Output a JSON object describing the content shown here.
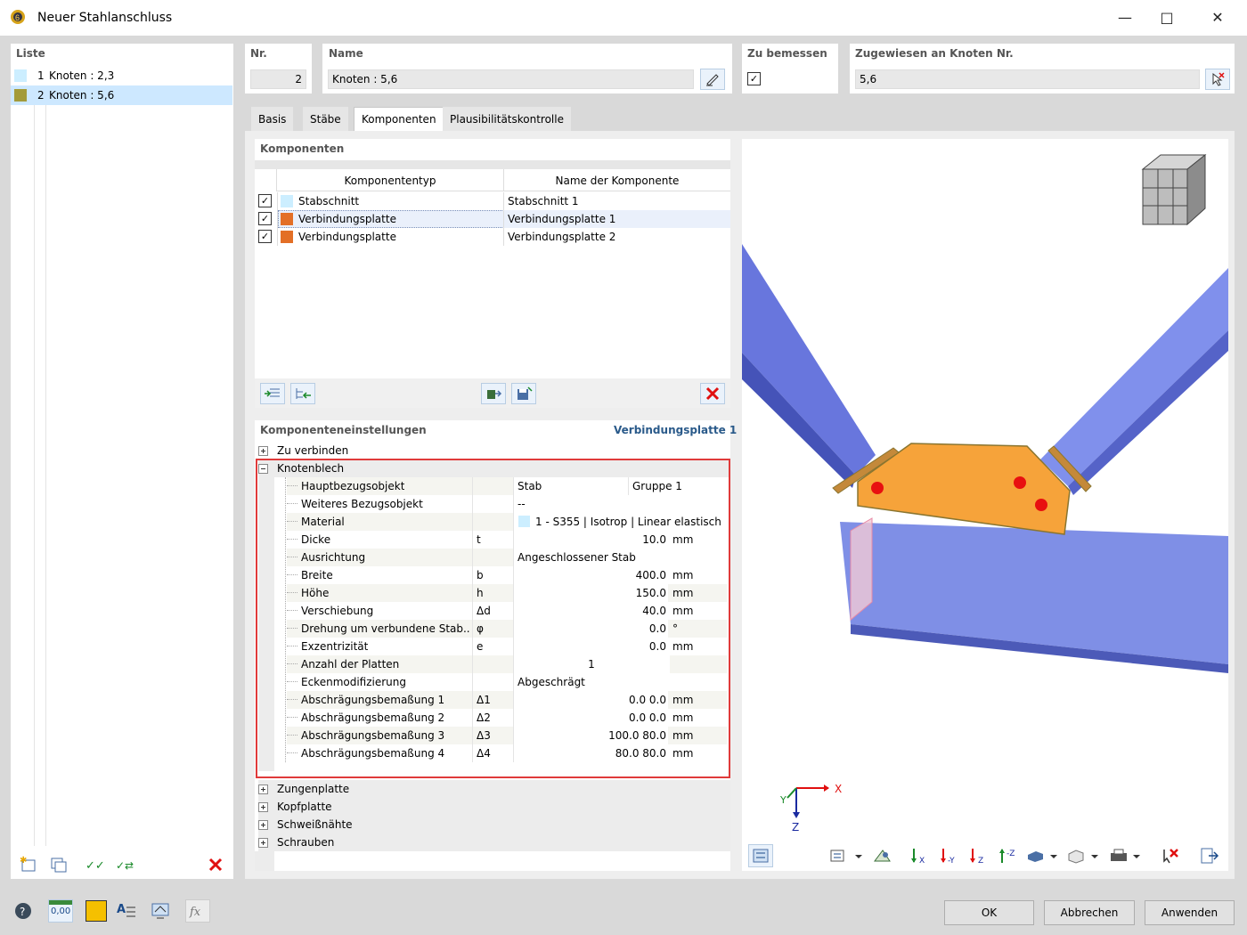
{
  "window": {
    "title": "Neuer Stahlanschluss"
  },
  "liste": {
    "header": "Liste",
    "items": [
      {
        "nr": "1",
        "label": "Knoten : 2,3",
        "color": "#cceeff"
      },
      {
        "nr": "2",
        "label": "Knoten : 5,6",
        "color": "#a39b3a"
      }
    ]
  },
  "fields": {
    "nr_label": "Nr.",
    "nr_value": "2",
    "name_label": "Name",
    "name_value": "Knoten : 5,6",
    "bemessen_label": "Zu bemessen",
    "zugewiesen_label": "Zugewiesen an Knoten Nr.",
    "zugewiesen_value": "5,6"
  },
  "tabs": [
    "Basis",
    "Stäbe",
    "Komponenten",
    "Plausibilitätskontrolle"
  ],
  "komponenten": {
    "header": "Komponenten",
    "col_typ": "Komponententyp",
    "col_name": "Name der Komponente",
    "rows": [
      {
        "typ": "Stabschnitt",
        "name": "Stabschnitt 1",
        "color": "#cceeff"
      },
      {
        "typ": "Verbindungsplatte",
        "name": "Verbindungsplatte 1",
        "color": "#e36f26"
      },
      {
        "typ": "Verbindungsplatte",
        "name": "Verbindungsplatte 2",
        "color": "#e36f26"
      }
    ]
  },
  "settings": {
    "header": "Komponenteneinstellungen",
    "current": "Verbindungsplatte 1",
    "sec_zu_verbinden": "Zu verbinden",
    "sec_knotenblech": "Knotenblech",
    "rows": [
      {
        "label": "Hauptbezugsobjekt",
        "sym": "",
        "value": "Stab",
        "extra": "Gruppe 1",
        "unit": ""
      },
      {
        "label": "Weiteres Bezugsobjekt",
        "sym": "",
        "value": "--",
        "extra": "",
        "unit": ""
      },
      {
        "label": "Material",
        "sym": "",
        "value": "1 - S355 | Isotrop | Linear elastisch",
        "extra": "",
        "unit": ""
      },
      {
        "label": "Dicke",
        "sym": "t",
        "num": "10.0",
        "unit": "mm"
      },
      {
        "label": "Ausrichtung",
        "sym": "",
        "value": "Angeschlossener Stab",
        "extra": "",
        "unit": ""
      },
      {
        "label": "Breite",
        "sym": "b",
        "num": "400.0",
        "unit": "mm"
      },
      {
        "label": "Höhe",
        "sym": "h",
        "num": "150.0",
        "unit": "mm"
      },
      {
        "label": "Verschiebung",
        "sym": "Δd",
        "num": "40.0",
        "unit": "mm"
      },
      {
        "label": "Drehung um verbundene Stab...",
        "sym": "φ",
        "num": "0.0",
        "unit": "°"
      },
      {
        "label": "Exzentrizität",
        "sym": "e",
        "num": "0.0",
        "unit": "mm"
      },
      {
        "label": "Anzahl der Platten",
        "sym": "",
        "center": "1",
        "unit": ""
      },
      {
        "label": "Eckenmodifizierung",
        "sym": "",
        "value": "Abgeschrägt",
        "extra": "",
        "unit": ""
      },
      {
        "label": "Abschrägungsbemaßung 1",
        "sym": "Δ1",
        "num": "0.0 0.0",
        "unit": "mm"
      },
      {
        "label": "Abschrägungsbemaßung 2",
        "sym": "Δ2",
        "num": "0.0 0.0",
        "unit": "mm"
      },
      {
        "label": "Abschrägungsbemaßung 3",
        "sym": "Δ3",
        "num": "100.0 80.0",
        "unit": "mm"
      },
      {
        "label": "Abschrägungsbemaßung 4",
        "sym": "Δ4",
        "num": "80.0 80.0",
        "unit": "mm"
      }
    ],
    "sec_zungenplatte": "Zungenplatte",
    "sec_kopfplatte": "Kopfplatte",
    "sec_schweissnaehte": "Schweißnähte",
    "sec_schrauben": "Schrauben"
  },
  "axes": {
    "x": "X",
    "y": "Y",
    "z": "Z"
  },
  "buttons": {
    "ok": "OK",
    "cancel": "Abbrechen",
    "apply": "Anwenden"
  },
  "status": {
    "value_icon_text": "0,00"
  },
  "colors": {
    "member": "#7f8fe6",
    "plate": "#f6a33a",
    "highlight": "#e03b3b",
    "bolt": "#e81010"
  }
}
